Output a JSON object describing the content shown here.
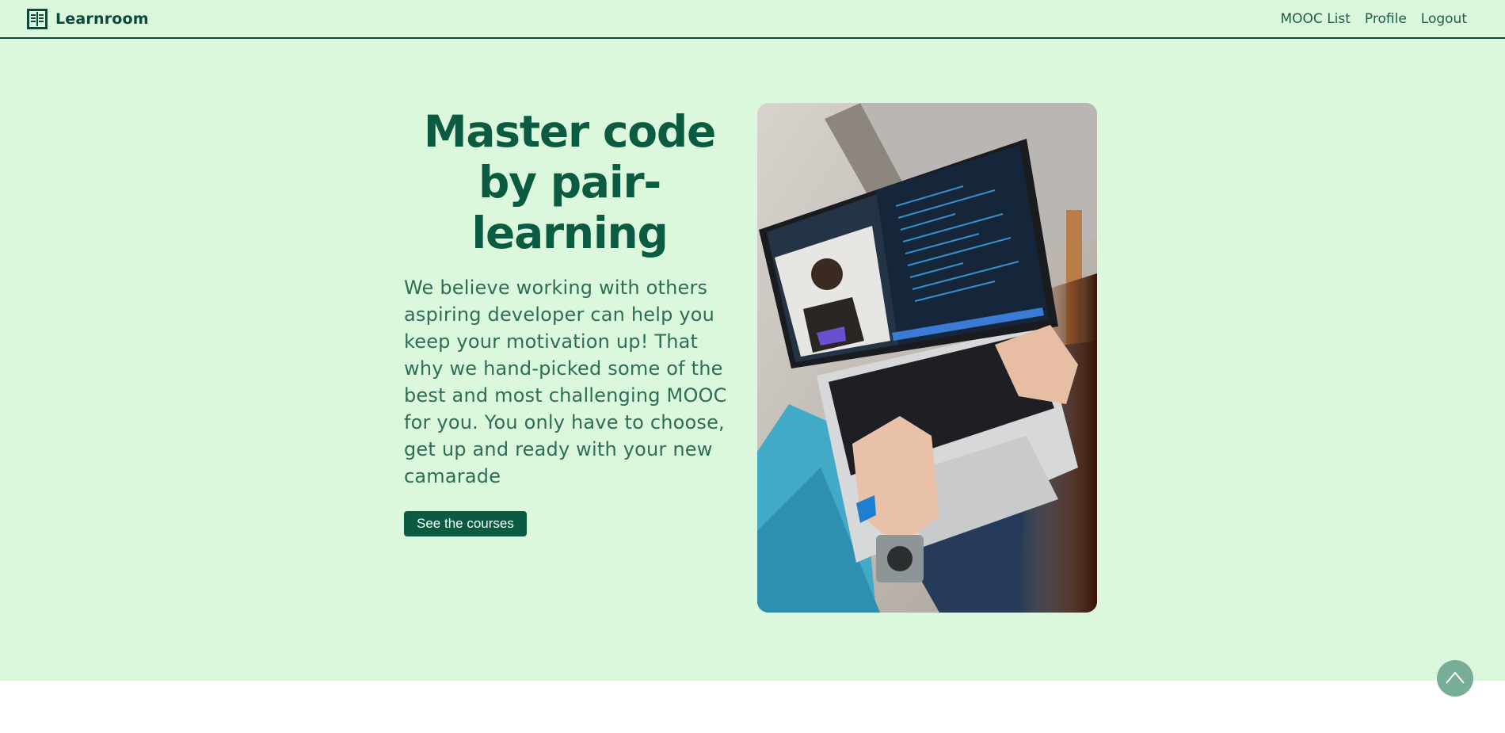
{
  "header": {
    "brand": "Learnroom",
    "logo_icon": "book-icon",
    "nav": [
      "MOOC List",
      "Profile",
      "Logout"
    ]
  },
  "hero": {
    "headline": "Master code by pair-learning",
    "body": "We believe working with others aspiring developer can help you keep your motivation up! That why we hand-picked some of the best and most challenging MOOC for you. You only have to choose, get up and ready with your new camarade",
    "cta_label": "See the courses",
    "image_alt": "Person typing on a laptop showing a code editor and a video call"
  },
  "scroll_top": {
    "icon": "chevron-up-icon"
  },
  "colors": {
    "background": "#dcf8dc",
    "brand": "#0b5a42",
    "text": "#2d6d58",
    "button": "#0b5a42",
    "scroll_button": "#78ad97"
  }
}
